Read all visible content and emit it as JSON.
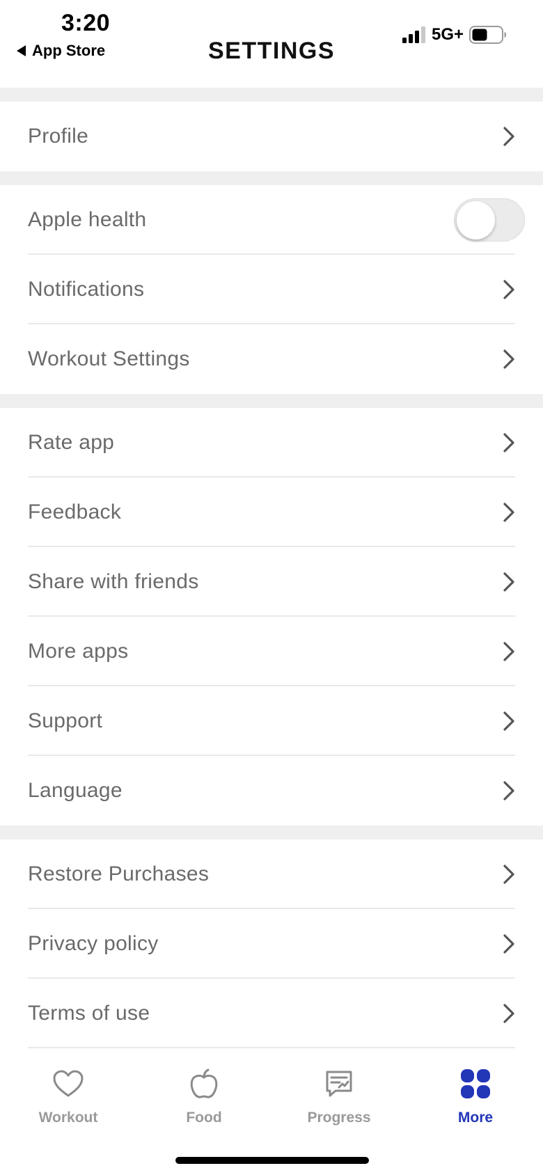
{
  "status_bar": {
    "time": "3:20",
    "back_label": "App Store",
    "network": "5G+",
    "icons": [
      "back-triangle-icon",
      "signal-icon",
      "battery-icon"
    ]
  },
  "header": {
    "title": "SETTINGS"
  },
  "sections": [
    {
      "items": [
        {
          "label": "Profile",
          "control": "chevron"
        }
      ]
    },
    {
      "items": [
        {
          "label": "Apple health",
          "control": "toggle",
          "toggle_on": false
        },
        {
          "label": "Notifications",
          "control": "chevron"
        },
        {
          "label": "Workout Settings",
          "control": "chevron"
        }
      ]
    },
    {
      "items": [
        {
          "label": "Rate app",
          "control": "chevron"
        },
        {
          "label": "Feedback",
          "control": "chevron"
        },
        {
          "label": "Share with friends",
          "control": "chevron"
        },
        {
          "label": "More apps",
          "control": "chevron"
        },
        {
          "label": "Support",
          "control": "chevron"
        },
        {
          "label": "Language",
          "control": "chevron"
        }
      ]
    },
    {
      "items": [
        {
          "label": "Restore Purchases",
          "control": "chevron"
        },
        {
          "label": "Privacy policy",
          "control": "chevron"
        },
        {
          "label": "Terms of use",
          "control": "chevron"
        }
      ]
    }
  ],
  "tabbar": {
    "active": "More",
    "tabs": [
      {
        "label": "Workout",
        "icon": "heart-icon"
      },
      {
        "label": "Food",
        "icon": "apple-icon"
      },
      {
        "label": "Progress",
        "icon": "progress-chart-icon"
      },
      {
        "label": "More",
        "icon": "grid-icon"
      }
    ]
  },
  "colors": {
    "accent": "#2236b8",
    "inactive_tab": "#9a9a9a",
    "row_text": "#6a6a6a",
    "section_gap": "#efefef"
  }
}
